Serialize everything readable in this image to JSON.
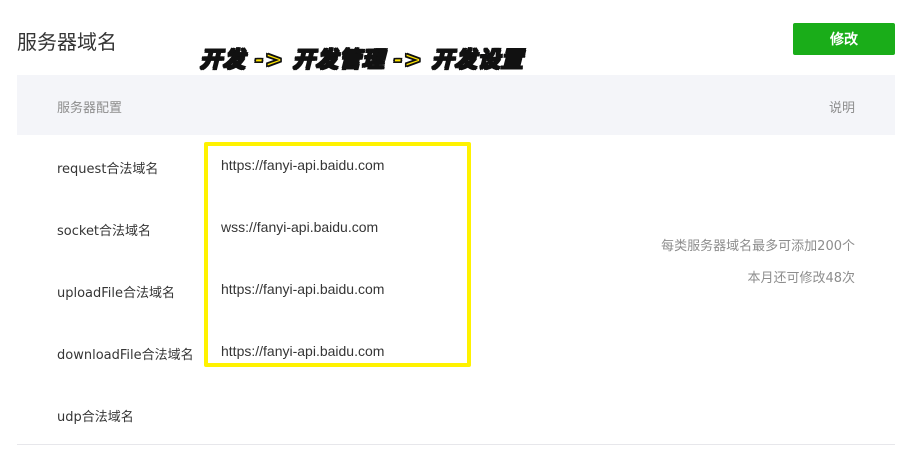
{
  "header": {
    "title": "服务器域名",
    "edit_label": "修改",
    "accent": "#1aad19"
  },
  "annotation": {
    "text": "开发 -> 开发管理 -> 开发设置",
    "color": "#ffe600"
  },
  "table": {
    "col_config": "服务器配置",
    "col_desc": "说明",
    "rows": [
      {
        "label": "request合法域名",
        "value": "https://fanyi-api.baidu.com"
      },
      {
        "label": "socket合法域名",
        "value": "wss://fanyi-api.baidu.com"
      },
      {
        "label": "uploadFile合法域名",
        "value": "https://fanyi-api.baidu.com"
      },
      {
        "label": "downloadFile合法域名",
        "value": "https://fanyi-api.baidu.com"
      },
      {
        "label": "udp合法域名",
        "value": ""
      }
    ],
    "desc_lines": [
      "每类服务器域名最多可添加200个",
      "本月还可修改48次"
    ]
  }
}
